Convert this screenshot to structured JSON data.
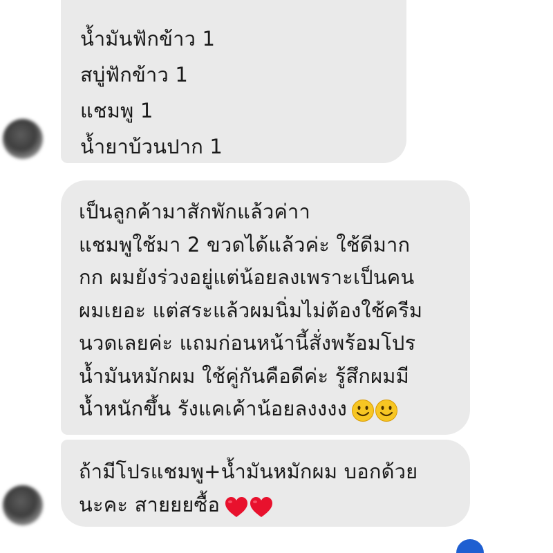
{
  "messages": [
    {
      "lines": [
        "น้ำมันฟักข้าว 1",
        "สบู่ฟักข้าว 1",
        "แชมพู 1",
        "น้ำยาบ้วนปาก 1"
      ]
    },
    {
      "lines": [
        "เป็นลูกค้ามาสักพักแล้วค่าา",
        "แชมพูใช้มา 2 ขวดได้แล้วค่ะ ใช้ดีมาก",
        "กก ผมยังร่วงอยู่แต่น้อยลงเพราะเป็นคน",
        "ผมเยอะ แต่สระแล้วผมนิ่มไม่ต้องใช้ครีม",
        "นวดเลยค่ะ แถมก่อนหน้านี้สั่งพร้อมโปร",
        "น้ำมันหมักผม ใช้คู่กันคือดีค่ะ รู้สึกผมมี",
        "น้ำหนักขึ้น รังแคเค้าน้อยลงงงง"
      ],
      "emoji": "slightly-smiling-face-icon"
    },
    {
      "lines": [
        "ถ้ามีโปรแชมพู+น้ำมันหมักผม บอกด้วย",
        "นะคะ สายยยซื้อ"
      ],
      "emoji": "red-heart-icon"
    }
  ],
  "colors": {
    "bubble": "#eaeaea",
    "text": "#1a1a1a",
    "heart": "#e8112d",
    "smiley": "#f7c623",
    "seen_indicator": "#1f5fd1"
  }
}
